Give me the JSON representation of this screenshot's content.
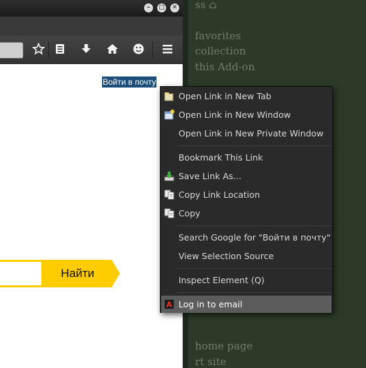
{
  "background_page": {
    "lines": [
      "ss ⌂",
      "favorites",
      "collection",
      "this Add-on",
      "home page",
      "rt site"
    ]
  },
  "window": {
    "controls": {
      "minimize": "–",
      "maximize": "□",
      "close": "✕"
    }
  },
  "navbar": {
    "icons": [
      "star-icon",
      "reading-list-icon",
      "download-icon",
      "home-icon",
      "smiley-icon",
      "menu-icon"
    ]
  },
  "content": {
    "selected_link": "Войти в почту",
    "search_button": "Найти"
  },
  "context_menu": {
    "items": [
      {
        "label": "Open Link in New Tab",
        "icon": "new-tab-icon"
      },
      {
        "label": "Open Link in New Window",
        "icon": "new-window-icon"
      },
      {
        "label": "Open Link in New Private Window",
        "icon": ""
      },
      {
        "label": "Bookmark This Link",
        "icon": ""
      },
      {
        "label": "Save Link As...",
        "icon": "save-icon"
      },
      {
        "label": "Copy Link Location",
        "icon": "copy-link-icon"
      },
      {
        "label": "Copy",
        "icon": "copy-icon"
      },
      {
        "label": "Search Google for \"Войти в почту\"",
        "icon": ""
      },
      {
        "label": "View Selection Source",
        "icon": ""
      },
      {
        "label": "Inspect Element (Q)",
        "icon": ""
      },
      {
        "label": "Log in to email",
        "icon": "login-extension-icon"
      }
    ]
  }
}
